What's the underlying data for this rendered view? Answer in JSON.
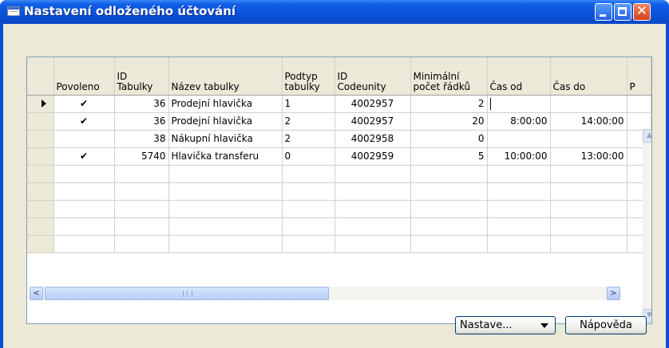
{
  "window": {
    "title": "Nastavení odloženého účtování"
  },
  "grid": {
    "headers": {
      "povoleno": "Povoleno",
      "id_tabulky": [
        "ID",
        "Tabulky"
      ],
      "nazev": "Název tabulky",
      "podtyp": [
        "Podtyp",
        "tabulky"
      ],
      "id_codeunity": [
        "ID",
        "Codeunity"
      ],
      "min_pocet": [
        "Minimální",
        "počet řádků"
      ],
      "cas_od": "Čas od",
      "cas_do": "Čas do",
      "p": "P"
    },
    "rows": [
      {
        "povoleno": "✔",
        "id_tabulky": "36",
        "nazev": "Prodejní hlavička",
        "podtyp": "1",
        "id_codeunity": "4002957",
        "min_pocet": "2",
        "cas_od": "",
        "cas_do": "",
        "p": ""
      },
      {
        "povoleno": "✔",
        "id_tabulky": "36",
        "nazev": "Prodejní hlavička",
        "podtyp": "2",
        "id_codeunity": "4002957",
        "min_pocet": "20",
        "cas_od": "8:00:00",
        "cas_do": "14:00:00",
        "p": ""
      },
      {
        "povoleno": "",
        "id_tabulky": "38",
        "nazev": "Nákupní hlavička",
        "podtyp": "2",
        "id_codeunity": "4002958",
        "min_pocet": "0",
        "cas_od": "",
        "cas_do": "",
        "p": ""
      },
      {
        "povoleno": "✔",
        "id_tabulky": "5740",
        "nazev": "Hlavička transferu",
        "podtyp": "0",
        "id_codeunity": "4002959",
        "min_pocet": "5",
        "cas_od": "10:00:00",
        "cas_do": "13:00:00",
        "p": ""
      }
    ],
    "empty_rows": 5
  },
  "buttons": {
    "setup": "Nastave...",
    "help": "Nápověda"
  }
}
